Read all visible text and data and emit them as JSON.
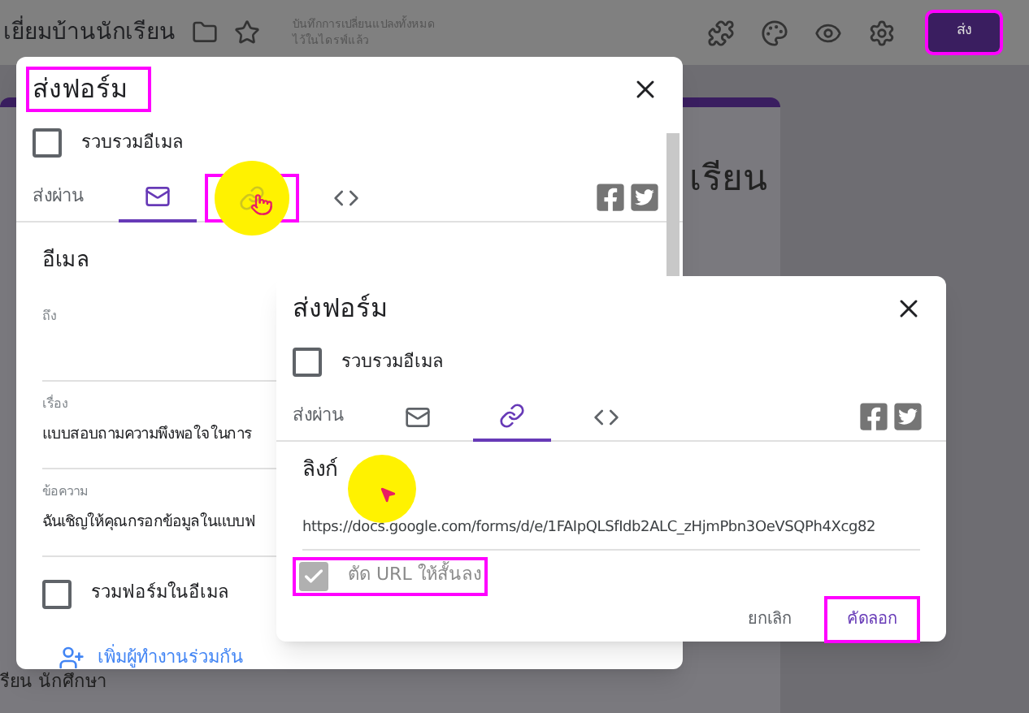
{
  "app_bar": {
    "title": "เยี่ยมบ้านนักเรียน",
    "save_status": [
      "บันทึกการเปลี่ยนแปลงทั้งหมด",
      "ไว้ในไดรฟ์แล้ว"
    ],
    "send_button": {
      "label": "ส่ง",
      "highlighted": true
    }
  },
  "background_texts": [
    "เรียน",
    "รียน นักศึกษา"
  ],
  "dialogs": [
    {
      "title": "ส่งฟอร์ม",
      "title_highlighted": true,
      "collect_emails": {
        "label": "รวบรวมอีเมล",
        "checked": false
      },
      "send_via_label": "ส่งผ่าน",
      "tabs": [
        {
          "kind": "email",
          "selected": true,
          "highlighted": false
        },
        {
          "kind": "link",
          "selected": false,
          "highlighted": true
        },
        {
          "kind": "embed",
          "selected": false,
          "highlighted": false
        }
      ],
      "section": {
        "kind": "email",
        "heading": "อีเมล",
        "fields": [
          {
            "label": "ถึง"
          },
          {
            "label": "เรื่อง",
            "value": "แบบสอบถามความพึงพอใจในการ"
          },
          {
            "label": "ข้อความ",
            "value": "ฉันเชิญให้คุณกรอกข้อมูลในแบบฟ"
          }
        ],
        "include_form": {
          "label": "รวมฟอร์มในอีเมล",
          "checked": false
        },
        "add_collaborators": "เพิ่มผู้ทำงานร่วมกัน"
      }
    },
    {
      "title": "ส่งฟอร์ม",
      "title_highlighted": false,
      "collect_emails": {
        "label": "รวบรวมอีเมล",
        "checked": false
      },
      "send_via_label": "ส่งผ่าน",
      "tabs": [
        {
          "kind": "email",
          "selected": false,
          "highlighted": false
        },
        {
          "kind": "link",
          "selected": true,
          "highlighted": false
        },
        {
          "kind": "embed",
          "selected": false,
          "highlighted": false
        }
      ],
      "section": {
        "kind": "link",
        "heading": "ลิงก์",
        "url": "https://docs.google.com/forms/d/e/1FAIpQLSfIdb2ALC_zHjmPbn3OeVSQPh4Xcg82",
        "shorten": {
          "label": "ตัด URL ให้สั้นลง",
          "checked": true,
          "highlighted": true
        },
        "buttons": [
          {
            "label": "ยกเลิก",
            "highlighted": false
          },
          {
            "label": "คัดลอก",
            "highlighted": true
          }
        ]
      }
    }
  ]
}
